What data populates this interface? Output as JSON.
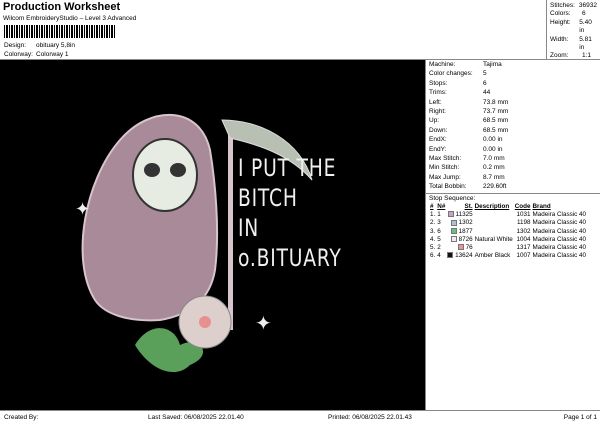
{
  "header": {
    "title": "Production Worksheet",
    "subtitle": "Wilcom EmbroideryStudio – Level 3 Advanced",
    "design_label": "Design:",
    "design": "obituary 5,8in",
    "colorway_label": "Colorway:",
    "colorway": "Colorway 1"
  },
  "stats": [
    {
      "k": "Stitches:",
      "v": "36932"
    },
    {
      "k": "Colors:",
      "v": "6"
    },
    {
      "k": "Height:",
      "v": "5.40 in"
    },
    {
      "k": "Width:",
      "v": "5.81 in"
    },
    {
      "k": "Zoom:",
      "v": "1:1"
    }
  ],
  "artwork": {
    "lines": [
      "I PUT THE",
      "BITCH",
      "IN",
      "o.BITUARY"
    ]
  },
  "machine": [
    {
      "k": "Machine:",
      "v": "Tajima"
    },
    {
      "k": "Color changes:",
      "v": "5"
    },
    {
      "k": "Stops:",
      "v": "6"
    },
    {
      "k": "Trims:",
      "v": "44"
    },
    {
      "k": "Left:",
      "v": "73.8 mm"
    },
    {
      "k": "Right:",
      "v": "73.7 mm"
    },
    {
      "k": "Up:",
      "v": "68.5 mm"
    },
    {
      "k": "Down:",
      "v": "68.5 mm"
    },
    {
      "k": "EndX:",
      "v": "0.00 in"
    },
    {
      "k": "EndY:",
      "v": "0.00 in"
    },
    {
      "k": "Max Stitch:",
      "v": "7.0 mm"
    },
    {
      "k": "Min Stitch:",
      "v": "0.2 mm"
    },
    {
      "k": "Max Jump:",
      "v": "8.7 mm"
    },
    {
      "k": "Total Bobbin:",
      "v": "229.60ft"
    }
  ],
  "stop_sequence": {
    "title": "Stop Sequence:",
    "headers": [
      "#",
      "N#",
      "St.",
      "Description",
      "Code",
      "Brand"
    ],
    "rows": [
      {
        "n": "1.",
        "nn": "1",
        "color": "#c9a2c8",
        "st": "11325",
        "desc": "",
        "code": "1031",
        "brand": "Madeira Classic 40"
      },
      {
        "n": "2.",
        "nn": "3",
        "color": "#a9bfdc",
        "st": "1302",
        "desc": "",
        "code": "1198",
        "brand": "Madeira Classic 40"
      },
      {
        "n": "3.",
        "nn": "6",
        "color": "#5fc47f",
        "st": "1877",
        "desc": "",
        "code": "1302",
        "brand": "Madeira Classic 40"
      },
      {
        "n": "4.",
        "nn": "5",
        "color": "#ececec",
        "st": "8726",
        "desc": "Natural White",
        "code": "1004",
        "brand": "Madeira Classic 40"
      },
      {
        "n": "5.",
        "nn": "2",
        "color": "#ea9393",
        "st": "76",
        "desc": "",
        "code": "1317",
        "brand": "Madeira Classic 40"
      },
      {
        "n": "6.",
        "nn": "4",
        "color": "#111111",
        "st": "13624",
        "desc": "Amber Black",
        "code": "1007",
        "brand": "Madeira Classic 40"
      }
    ]
  },
  "footer": {
    "created": "Created By:",
    "saved": "Last Saved: 06/08/2025 22.01.40",
    "printed": "Printed: 06/08/2025 22.01.43",
    "page": "Page 1 of 1"
  }
}
